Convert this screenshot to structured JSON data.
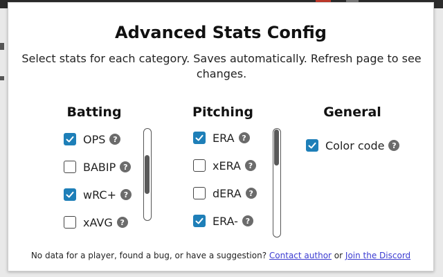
{
  "popup": {
    "title": "Advanced Stats Config",
    "subtitle": "Select stats for each category. Saves automatically. Refresh page to see changes."
  },
  "columns": {
    "batting": {
      "heading": "Batting",
      "items": [
        {
          "label": "OPS",
          "checked": true
        },
        {
          "label": "BABIP",
          "checked": false
        },
        {
          "label": "wRC+",
          "checked": true
        },
        {
          "label": "xAVG",
          "checked": false
        }
      ],
      "scroll_position": 0.5
    },
    "pitching": {
      "heading": "Pitching",
      "items": [
        {
          "label": "ERA",
          "checked": true
        },
        {
          "label": "xERA",
          "checked": false
        },
        {
          "label": "dERA",
          "checked": false
        },
        {
          "label": "ERA-",
          "checked": true
        }
      ],
      "scroll_position": 0.0
    },
    "general": {
      "heading": "General",
      "items": [
        {
          "label": "Color code",
          "checked": true
        }
      ]
    }
  },
  "help_glyph": "?",
  "footer": {
    "text": "No data for a player, found a bug, or have a suggestion?",
    "contact_link": "Contact author",
    "or_text": "or",
    "discord_link": "Join the Discord"
  },
  "colors": {
    "checkbox_accent": "#1e7fb8",
    "link": "#3b3bd1"
  }
}
